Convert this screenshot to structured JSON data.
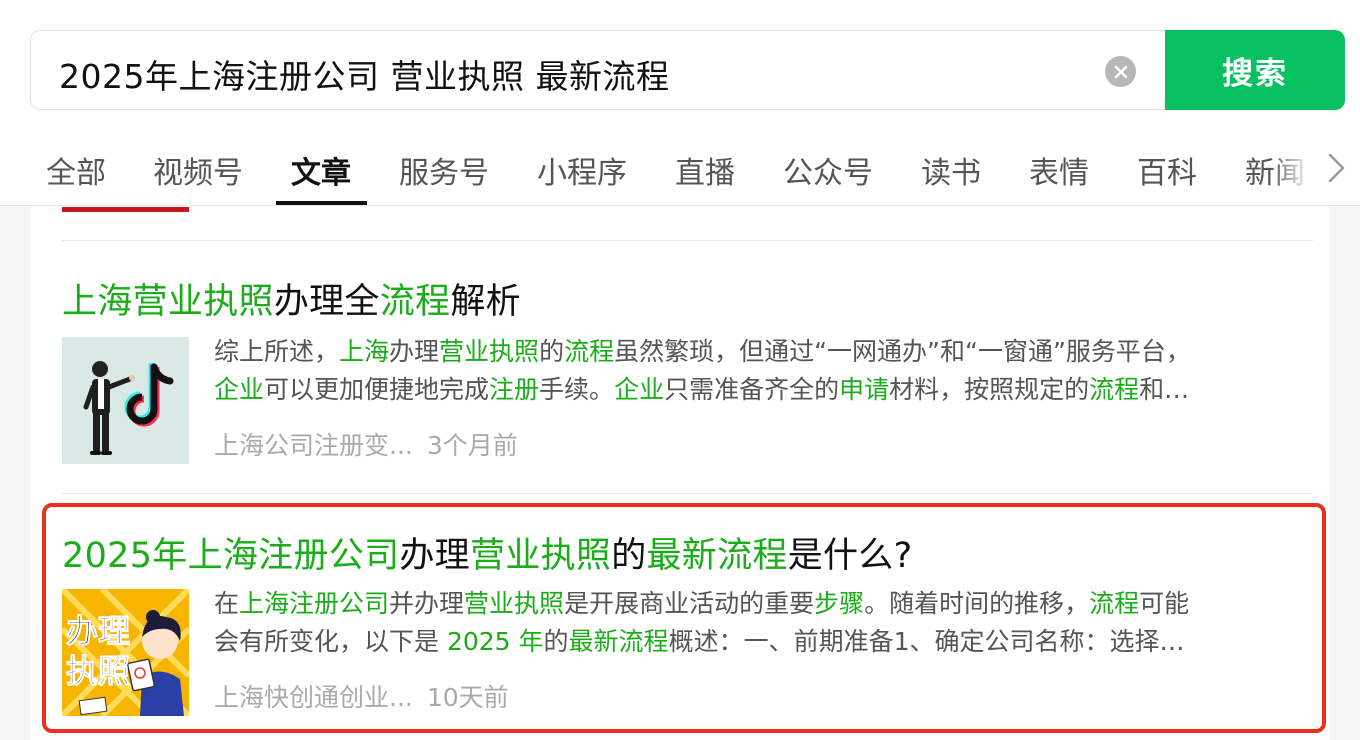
{
  "search": {
    "query": "2025年上海注册公司 营业执照 最新流程",
    "button_label": "搜索"
  },
  "tabs": [
    {
      "label": "全部",
      "active": false
    },
    {
      "label": "视频号",
      "active": false
    },
    {
      "label": "文章",
      "active": true
    },
    {
      "label": "服务号",
      "active": false
    },
    {
      "label": "小程序",
      "active": false
    },
    {
      "label": "直播",
      "active": false
    },
    {
      "label": "公众号",
      "active": false
    },
    {
      "label": "读书",
      "active": false
    },
    {
      "label": "表情",
      "active": false
    },
    {
      "label": "百科",
      "active": false
    },
    {
      "label": "新闻",
      "active": false
    }
  ],
  "results": [
    {
      "title_parts": [
        {
          "text": "上海营业执照",
          "hl": true
        },
        {
          "text": "办理全",
          "hl": false
        },
        {
          "text": "流程",
          "hl": true
        },
        {
          "text": "解析",
          "hl": false
        }
      ],
      "snippet_line1": [
        {
          "text": "综上所述，",
          "hl": false
        },
        {
          "text": "上海",
          "hl": true
        },
        {
          "text": "办理",
          "hl": false
        },
        {
          "text": "营业执照",
          "hl": true
        },
        {
          "text": "的",
          "hl": false
        },
        {
          "text": "流程",
          "hl": true
        },
        {
          "text": "虽然繁琐，但通过“一网通办”和“一窗通”服务平台，",
          "hl": false
        }
      ],
      "snippet_line2": [
        {
          "text": "企业",
          "hl": true
        },
        {
          "text": "可以更加便捷地完成",
          "hl": false
        },
        {
          "text": "注册",
          "hl": true
        },
        {
          "text": "手续。",
          "hl": false
        },
        {
          "text": "企业",
          "hl": true
        },
        {
          "text": "只需准备齐全的",
          "hl": false
        },
        {
          "text": "申请",
          "hl": true
        },
        {
          "text": "材料，按照规定的",
          "hl": false
        },
        {
          "text": "流程",
          "hl": true
        },
        {
          "text": "和…",
          "hl": false
        }
      ],
      "source": "上海公司注册变...",
      "time": "3个月前",
      "thumb_icon": "tiktok-logo-with-businessman"
    },
    {
      "title_parts": [
        {
          "text": "2025年上海注册公司",
          "hl": true
        },
        {
          "text": "办理",
          "hl": false
        },
        {
          "text": "营业执照",
          "hl": true
        },
        {
          "text": "的",
          "hl": false
        },
        {
          "text": "最新流程",
          "hl": true
        },
        {
          "text": "是什么?",
          "hl": false
        }
      ],
      "snippet_line1": [
        {
          "text": "在",
          "hl": false
        },
        {
          "text": "上海注册公司",
          "hl": true
        },
        {
          "text": "并办理",
          "hl": false
        },
        {
          "text": "营业执照",
          "hl": true
        },
        {
          "text": "是开展商业活动的重要",
          "hl": false
        },
        {
          "text": "步骤",
          "hl": true
        },
        {
          "text": "。随着时间的推移，",
          "hl": false
        },
        {
          "text": "流程",
          "hl": true
        },
        {
          "text": "可能",
          "hl": false
        }
      ],
      "snippet_line2": [
        {
          "text": "会有所变化，以下是 ",
          "hl": false
        },
        {
          "text": "2025 年",
          "hl": true
        },
        {
          "text": "的",
          "hl": false
        },
        {
          "text": "最新流程",
          "hl": true
        },
        {
          "text": "概述：一、前期准备1、确定公司名称：选择…",
          "hl": false
        }
      ],
      "source": "上海快创通创业...",
      "time": "10天前",
      "thumb_text_1": "办理",
      "thumb_text_2": "执照",
      "thumb_icon": "business-license-cartoon"
    }
  ],
  "colors": {
    "accent": "#07c160",
    "highlight_text": "#1aad19",
    "frame": "#e8321f"
  }
}
